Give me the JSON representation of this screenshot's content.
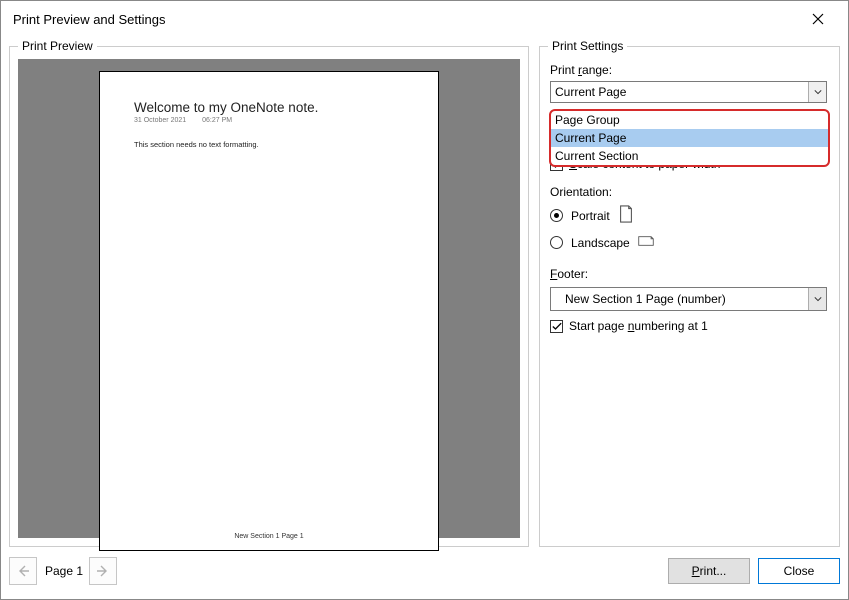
{
  "window": {
    "title": "Print Preview and Settings"
  },
  "preview": {
    "legend": "Print Preview",
    "page": {
      "title": "Welcome to my OneNote note.",
      "date": "31 October 2021",
      "time": "06:27 PM",
      "body": "This section needs no text formatting.",
      "footer": "New Section 1 Page 1"
    }
  },
  "settings": {
    "legend": "Print Settings",
    "range_label_pre": "Print ",
    "range_label_u": "r",
    "range_label_post": "ange:",
    "range_value": "Current Page",
    "range_options": [
      "Page Group",
      "Current Page",
      "Current Section"
    ],
    "range_selected_index": 1,
    "scale_label_pre": "",
    "scale_label_u": "S",
    "scale_label_post": "cale content to paper width",
    "scale_checked": true,
    "orientation_label": "Orientation:",
    "orientation": {
      "portrait": "Portrait",
      "landscape": "Landscape",
      "selected": "portrait"
    },
    "footer_label_u": "F",
    "footer_label_post": "ooter:",
    "footer_value": "New Section 1 Page (number)",
    "start_num_pre": "Start page ",
    "start_num_u": "n",
    "start_num_post": "umbering at 1",
    "start_num_checked": true
  },
  "nav": {
    "page_indicator": "Page 1"
  },
  "buttons": {
    "print_u": "P",
    "print_post": "rint...",
    "close": "Close"
  }
}
